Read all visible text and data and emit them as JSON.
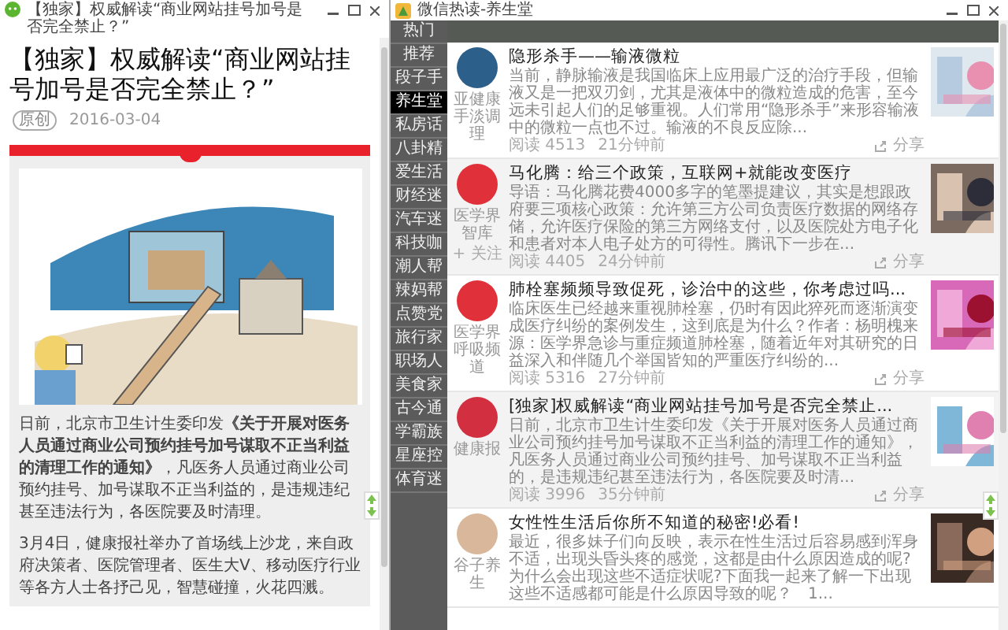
{
  "left_window": {
    "title": "【独家】权威解读“商业网站挂号加号是否完全禁止？”",
    "article": {
      "title": "【独家】权威解读“商业网站挂号加号是否完全禁止？”",
      "tag": "原创",
      "date": "2016-03-04",
      "paragraphs": [
        "日前，北京市卫生计生委印发**《关于开展对医务人员通过商业公司预约挂号加号谋取不正当利益的清理工作的通知》**，凡医务人员通过商业公司预约挂号、加号谋取不正当利益的，是违规违纪甚至违法行为，各医院要及时清理。",
        "3月4日，健康报社举办了首场线上沙龙，来自政府决策者、医院管理者、医生大V、移动医疗行业等各方人士各抒己见，智慧碰撞，火花四溅。"
      ]
    }
  },
  "right_window": {
    "title": "微信热读-养生堂",
    "categories": [
      {
        "label": "热门",
        "selected": false
      },
      {
        "label": "推荐",
        "selected": false
      },
      {
        "label": "段子手",
        "selected": false
      },
      {
        "label": "养生堂",
        "selected": true
      },
      {
        "label": "私房话",
        "selected": false
      },
      {
        "label": "八卦精",
        "selected": false
      },
      {
        "label": "爱生活",
        "selected": false
      },
      {
        "label": "财经迷",
        "selected": false
      },
      {
        "label": "汽车迷",
        "selected": false
      },
      {
        "label": "科技咖",
        "selected": false
      },
      {
        "label": "潮人帮",
        "selected": false
      },
      {
        "label": "辣妈帮",
        "selected": false
      },
      {
        "label": "点赞党",
        "selected": false
      },
      {
        "label": "旅行家",
        "selected": false
      },
      {
        "label": "职场人",
        "selected": false
      },
      {
        "label": "美食家",
        "selected": false
      },
      {
        "label": "古今通",
        "selected": false
      },
      {
        "label": "学霸族",
        "selected": false
      },
      {
        "label": "星座控",
        "selected": false
      },
      {
        "label": "体育迷",
        "selected": false
      }
    ],
    "feed": [
      {
        "author": "亚健康手淡调理",
        "title": "隐形杀手——输液微粒",
        "summary": "当前，静脉输液是我国临床上应用最广泛的治疗手段，但输液又是一把双刃剑，尤其是液体中的微粒造成的危害，至今远未引起人们的足够重视。人们常用“隐形杀手”来形容输液中的微粒一点也不过。输液的不良反应除...",
        "reads": "阅读 4513",
        "time": "21分钟前",
        "share": "分享"
      },
      {
        "author": "医学界智库",
        "follow": "+ 关注",
        "title": "马化腾：给三个政策，互联网+就能改变医疗",
        "summary": "导语：马化腾花费4000多字的笔墨提建议，其实是想跟政府要三项核心政策：允许第三方公司负责医疗数据的网络存储，允许医疗保险的第三方网络支付，以及医院处方电子化和患者对本人电子处方的可得性。腾讯下一步在...",
        "reads": "阅读 4405",
        "time": "24分钟前",
        "share": "分享"
      },
      {
        "author": "医学界呼吸频道",
        "title": "肺栓塞频频导致促死，诊治中的这些，你考虑过吗...",
        "summary": "临床医生已经越来重视肺栓塞，仍时有因此猝死而逐渐演变成医疗纠纷的案例发生，这到底是为什么？作者：杨明槐来源：医学界急诊与重症频道肺栓塞，随着近年对其研究的日益深入和伴随几个举国皆知的严重医疗纠纷的...",
        "reads": "阅读 5316",
        "time": "27分钟前",
        "share": "分享"
      },
      {
        "author": "健康报",
        "title": "[独家]权威解读“商业网站挂号加号是否完全禁止...",
        "summary": "日前，北京市卫生计生委印发《关于开展对医务人员通过商业公司预约挂号加号谋取不正当利益的清理工作的通知》，凡医务人员通过商业公司预约挂号、加号谋取不正当利益的，是违规违纪甚至违法行为，各医院要及时清...",
        "reads": "阅读 3996",
        "time": "35分钟前",
        "share": "分享"
      },
      {
        "author": "谷子养生",
        "title": "女性性生活后你所不知道的秘密!必看!",
        "summary": "最近，很多妹子们向反映，表示在性生活过后容易感到浑身不适，出现头昏头疼的感觉，这都是由什么原因造成的呢?为什么会出现这些不适症状呢?下面我一起来了解一下出现这些不适感都可能是什么原因导致的呢？　1..."
      }
    ]
  }
}
